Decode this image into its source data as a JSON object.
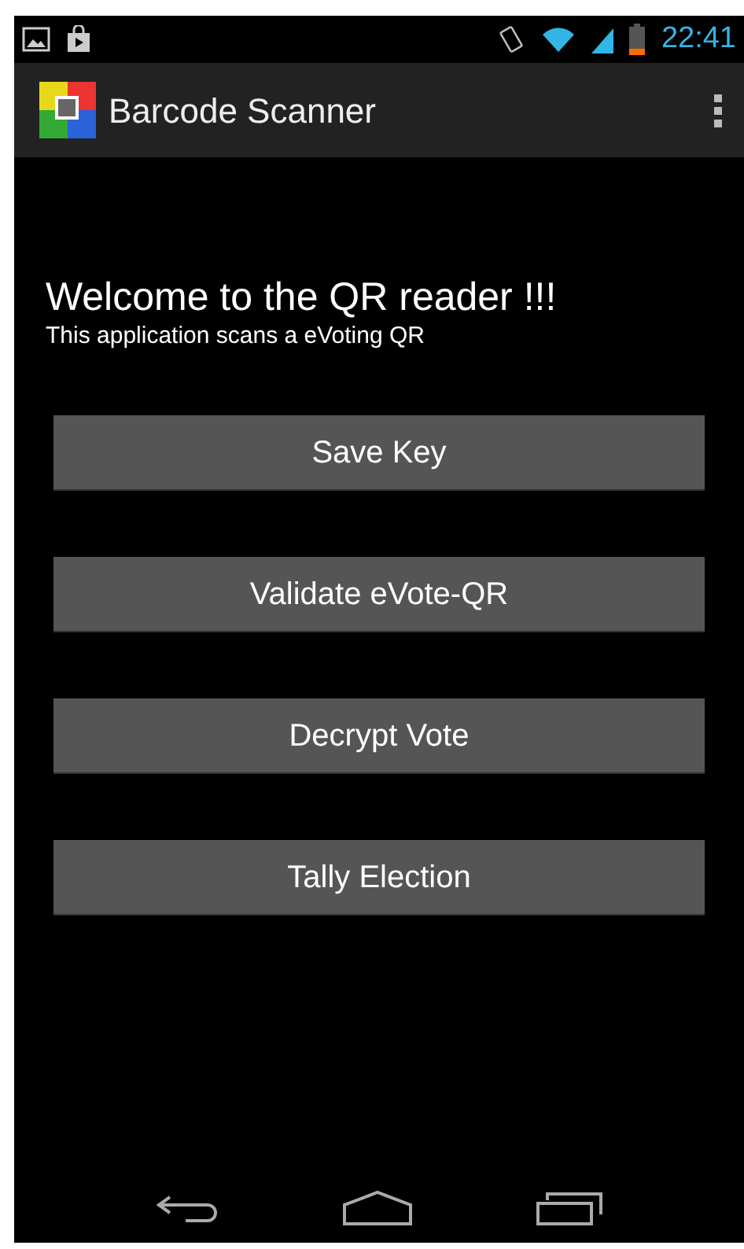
{
  "status_bar": {
    "time": "22:41"
  },
  "action_bar": {
    "title": "Barcode Scanner"
  },
  "content": {
    "heading": "Welcome to the QR reader !!!",
    "subtitle": "This application scans a eVoting QR"
  },
  "buttons": [
    {
      "label": "Save Key"
    },
    {
      "label": "Validate eVote-QR"
    },
    {
      "label": "Decrypt Vote"
    },
    {
      "label": "Tally Election"
    }
  ]
}
